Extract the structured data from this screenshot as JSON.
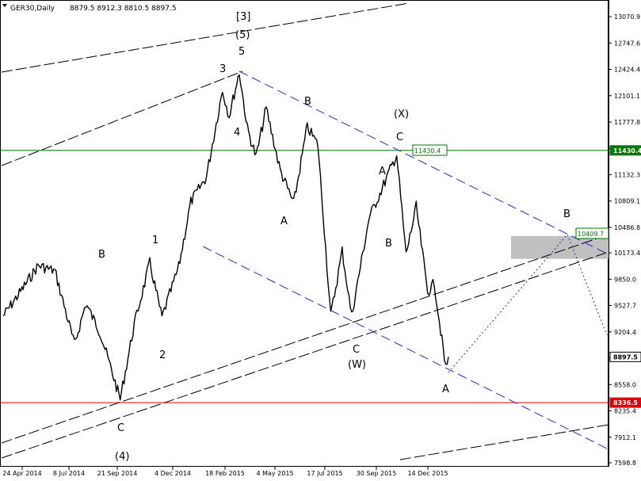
{
  "header": {
    "symbol": "GER30,Daily",
    "ohlc": "8879.5 8912.3 8810.5 8897.5"
  },
  "chart_data": {
    "type": "candlestick",
    "symbol": "GER30",
    "timeframe": "Daily",
    "ohlc_last": {
      "open": 8879.5,
      "high": 8912.3,
      "low": 8810.5,
      "close": 8897.5
    },
    "y_ticks": [
      "13070.9",
      "12747.6",
      "12424.4",
      "12101.1",
      "11777.8",
      "11454.6",
      "11132.3",
      "10809.1",
      "10486.8",
      "10173.4",
      "9850.0",
      "9527.7",
      "9204.4",
      "8881.2",
      "8558.0",
      "8235.4",
      "7912.1",
      "7598.8"
    ],
    "x_ticks": [
      "24 Apr 2014",
      "8 Jul 2014",
      "21 Sep 2014",
      "4 Dec 2014",
      "18 Feb 2015",
      "4 May 2015",
      "17 Jul 2015",
      "30 Sep 2015",
      "14 Dec 2015"
    ],
    "price_labels": [
      {
        "text": "11430.4",
        "color": "#007a00"
      },
      {
        "text": "8897.5",
        "color": "#000000"
      },
      {
        "text": "8336.5",
        "color": "#e00000"
      }
    ],
    "horizontal_lines": [
      {
        "value": 11430.4,
        "color": "#007a00"
      },
      {
        "value": 8336.5,
        "color": "#e00000"
      }
    ],
    "chart_labels": [
      {
        "text": "11430.4",
        "color": "#007a00"
      },
      {
        "text": "10409.7",
        "color": "#007a00"
      }
    ],
    "wave_labels": [
      "[3]",
      "(5)",
      "5",
      "3",
      "4",
      "B",
      "1",
      "2",
      "C",
      "(4)",
      "B",
      "A",
      "(X)",
      "C",
      "A",
      "B",
      "C",
      "(W)",
      "A",
      "B"
    ],
    "shaded_zone": {
      "from": 10100,
      "to": 10380,
      "color": "#c0c0c0"
    },
    "path_anchors": [
      {
        "date": "2014-04-24",
        "price": 9400
      },
      {
        "date": "2014-05-20",
        "price": 9700
      },
      {
        "date": "2014-06-15",
        "price": 10020
      },
      {
        "date": "2014-07-10",
        "price": 9950
      },
      {
        "date": "2014-08-08",
        "price": 9050
      },
      {
        "date": "2014-08-25",
        "price": 9550
      },
      {
        "date": "2014-09-15",
        "price": 9200
      },
      {
        "date": "2014-10-15",
        "price": 8380
      },
      {
        "date": "2014-11-05",
        "price": 9300
      },
      {
        "date": "2014-11-28",
        "price": 10050
      },
      {
        "date": "2014-12-16",
        "price": 9380
      },
      {
        "date": "2015-01-10",
        "price": 10000
      },
      {
        "date": "2015-01-28",
        "price": 10800
      },
      {
        "date": "2015-02-20",
        "price": 11100
      },
      {
        "date": "2015-03-16",
        "price": 12170
      },
      {
        "date": "2015-03-26",
        "price": 11850
      },
      {
        "date": "2015-04-10",
        "price": 12390
      },
      {
        "date": "2015-04-22",
        "price": 11700
      },
      {
        "date": "2015-05-05",
        "price": 11350
      },
      {
        "date": "2015-05-20",
        "price": 11950
      },
      {
        "date": "2015-06-10",
        "price": 11180
      },
      {
        "date": "2015-06-30",
        "price": 10780
      },
      {
        "date": "2015-07-20",
        "price": 11720
      },
      {
        "date": "2015-08-05",
        "price": 11500
      },
      {
        "date": "2015-08-24",
        "price": 9400
      },
      {
        "date": "2015-09-10",
        "price": 10200
      },
      {
        "date": "2015-09-24",
        "price": 9400
      },
      {
        "date": "2015-10-20",
        "price": 10600
      },
      {
        "date": "2015-11-05",
        "price": 10900
      },
      {
        "date": "2015-11-30",
        "price": 11380
      },
      {
        "date": "2015-12-14",
        "price": 10150
      },
      {
        "date": "2015-12-29",
        "price": 10740
      },
      {
        "date": "2016-01-15",
        "price": 9700
      },
      {
        "date": "2016-01-25",
        "price": 9800
      },
      {
        "date": "2016-02-11",
        "price": 8750
      },
      {
        "date": "2016-02-15",
        "price": 8897
      }
    ]
  }
}
